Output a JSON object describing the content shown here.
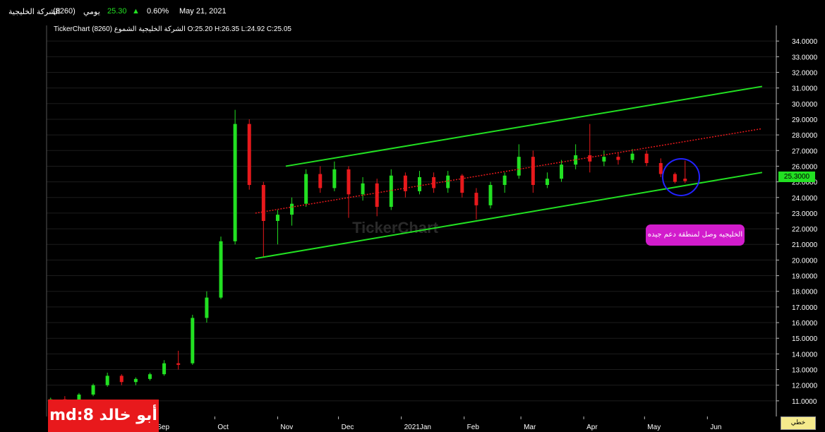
{
  "header": {
    "company": "الشركة الخليجية",
    "symbol": "(8260)",
    "period": "يومي",
    "price": "25.30",
    "change_pct": "0.60%",
    "date": "May 21, 2021",
    "up_color": "#22e022",
    "arrow_icon": "triangle-up-icon"
  },
  "ohlc_line": "TickerChart الشركة الخليجية الشموع (8260) O:25.20 H:26.35 L:24.92 C:25.05",
  "watermark": "TickerChart",
  "stamp_label": "md:8 أبو خالد",
  "callout_text": "الخليجيه وصل لمنطقة دعم جيده",
  "style_button_label": "خطي",
  "chart_data": {
    "type": "candlestick",
    "title": "",
    "xlabel": "",
    "ylabel": "",
    "ylim": [
      10,
      35
    ],
    "y_tick_labels": [
      "11.0000",
      "12.0000",
      "13.0000",
      "14.0000",
      "15.0000",
      "16.0000",
      "17.0000",
      "18.0000",
      "19.0000",
      "20.0000",
      "21.0000",
      "22.0000",
      "23.0000",
      "24.0000",
      "25.0000",
      "26.0000",
      "27.0000",
      "28.0000",
      "29.0000",
      "30.0000",
      "31.0000",
      "32.0000",
      "33.0000",
      "34.0000"
    ],
    "x_tick_labels": [
      "Sep",
      "Oct",
      "Nov",
      "Dec",
      "2021Jan",
      "Feb",
      "Mar",
      "Apr",
      "May",
      "Jun"
    ],
    "last_price_label": "25.3000",
    "colors": {
      "up": "#22e022",
      "down": "#e8191c",
      "channel": "#22e022",
      "midline": "#e8191c",
      "circle": "#2222ff"
    },
    "channel": {
      "upper": {
        "start": [
          "Nov 05, 2020",
          26.0
        ],
        "end": [
          "Jun 28, 2021",
          31.1
        ]
      },
      "lower": {
        "start": [
          "Oct 21, 2020",
          20.1
        ],
        "end": [
          "Jun 28, 2021",
          25.6
        ]
      },
      "middle": {
        "start": [
          "Oct 21, 2020",
          23.0
        ],
        "end": [
          "Jun 28, 2021",
          28.4
        ]
      }
    },
    "highlight_circle": {
      "date": "May 19, 2021",
      "price": 25.3
    },
    "candle_columns": [
      "date",
      "open",
      "high",
      "low",
      "close"
    ],
    "candles": [
      [
        "Jul 12, 2020",
        11.0,
        11.2,
        10.8,
        11.1
      ],
      [
        "Jul 19, 2020",
        11.1,
        11.3,
        10.9,
        11.0
      ],
      [
        "Jul 26, 2020",
        11.0,
        11.5,
        10.9,
        11.4
      ],
      [
        "Aug 02, 2020",
        11.4,
        12.1,
        11.3,
        12.0
      ],
      [
        "Aug 09, 2020",
        12.0,
        12.8,
        11.9,
        12.6
      ],
      [
        "Aug 16, 2020",
        12.6,
        12.7,
        12.0,
        12.2
      ],
      [
        "Aug 23, 2020",
        12.2,
        12.5,
        12.0,
        12.4
      ],
      [
        "Aug 30, 2020",
        12.4,
        12.8,
        12.3,
        12.7
      ],
      [
        "Sep 06, 2020",
        12.7,
        13.6,
        12.6,
        13.4
      ],
      [
        "Sep 13, 2020",
        13.4,
        14.2,
        13.0,
        13.3
      ],
      [
        "Sep 20, 2020",
        13.4,
        16.5,
        13.3,
        16.3
      ],
      [
        "Sep 27, 2020",
        16.3,
        18.0,
        16.0,
        17.6
      ],
      [
        "Oct 04, 2020",
        17.6,
        21.5,
        17.5,
        21.2
      ],
      [
        "Oct 11, 2020",
        21.2,
        29.6,
        21.0,
        28.7
      ],
      [
        "Oct 18, 2020",
        28.7,
        29.0,
        24.5,
        24.8
      ],
      [
        "Oct 25, 2020",
        24.8,
        25.0,
        20.2,
        22.5
      ],
      [
        "Nov 01, 2020",
        22.5,
        23.2,
        21.0,
        22.9
      ],
      [
        "Nov 08, 2020",
        22.9,
        24.0,
        22.2,
        23.6
      ],
      [
        "Nov 15, 2020",
        23.6,
        25.8,
        23.4,
        25.5
      ],
      [
        "Nov 22, 2020",
        25.5,
        26.0,
        24.3,
        24.6
      ],
      [
        "Nov 29, 2020",
        24.6,
        26.3,
        24.4,
        25.8
      ],
      [
        "Dec 06, 2020",
        25.8,
        26.0,
        22.7,
        24.2
      ],
      [
        "Dec 13, 2020",
        24.2,
        25.3,
        23.8,
        24.9
      ],
      [
        "Dec 20, 2020",
        24.9,
        25.2,
        22.8,
        23.4
      ],
      [
        "Dec 27, 2020",
        23.4,
        25.8,
        23.2,
        25.4
      ],
      [
        "Jan 03, 2021",
        25.4,
        25.6,
        24.0,
        24.4
      ],
      [
        "Jan 10, 2021",
        24.4,
        25.7,
        24.2,
        25.3
      ],
      [
        "Jan 17, 2021",
        25.3,
        25.6,
        24.3,
        24.6
      ],
      [
        "Jan 24, 2021",
        24.6,
        25.7,
        24.3,
        25.4
      ],
      [
        "Jan 31, 2021",
        25.4,
        25.5,
        24.0,
        24.3
      ],
      [
        "Feb 07, 2021",
        24.3,
        24.6,
        22.6,
        23.5
      ],
      [
        "Feb 14, 2021",
        23.5,
        25.0,
        23.3,
        24.8
      ],
      [
        "Feb 21, 2021",
        24.8,
        25.6,
        24.3,
        25.4
      ],
      [
        "Feb 28, 2021",
        25.4,
        27.4,
        25.2,
        26.6
      ],
      [
        "Mar 07, 2021",
        26.6,
        27.0,
        24.3,
        24.8
      ],
      [
        "Mar 14, 2021",
        24.8,
        25.6,
        24.6,
        25.2
      ],
      [
        "Mar 21, 2021",
        25.2,
        26.4,
        25.0,
        26.1
      ],
      [
        "Mar 28, 2021",
        26.1,
        27.4,
        25.8,
        26.7
      ],
      [
        "Apr 04, 2021",
        26.7,
        28.7,
        25.6,
        26.3
      ],
      [
        "Apr 11, 2021",
        26.3,
        27.0,
        26.0,
        26.6
      ],
      [
        "Apr 18, 2021",
        26.6,
        26.9,
        26.1,
        26.4
      ],
      [
        "Apr 25, 2021",
        26.4,
        27.1,
        26.2,
        26.8
      ],
      [
        "May 02, 2021",
        26.8,
        27.0,
        26.0,
        26.2
      ],
      [
        "May 09, 2021",
        26.2,
        26.5,
        25.3,
        25.5
      ],
      [
        "May 16, 2021",
        25.5,
        25.6,
        24.9,
        25.0
      ],
      [
        "May 21, 2021",
        25.2,
        26.35,
        24.92,
        25.05
      ]
    ]
  }
}
